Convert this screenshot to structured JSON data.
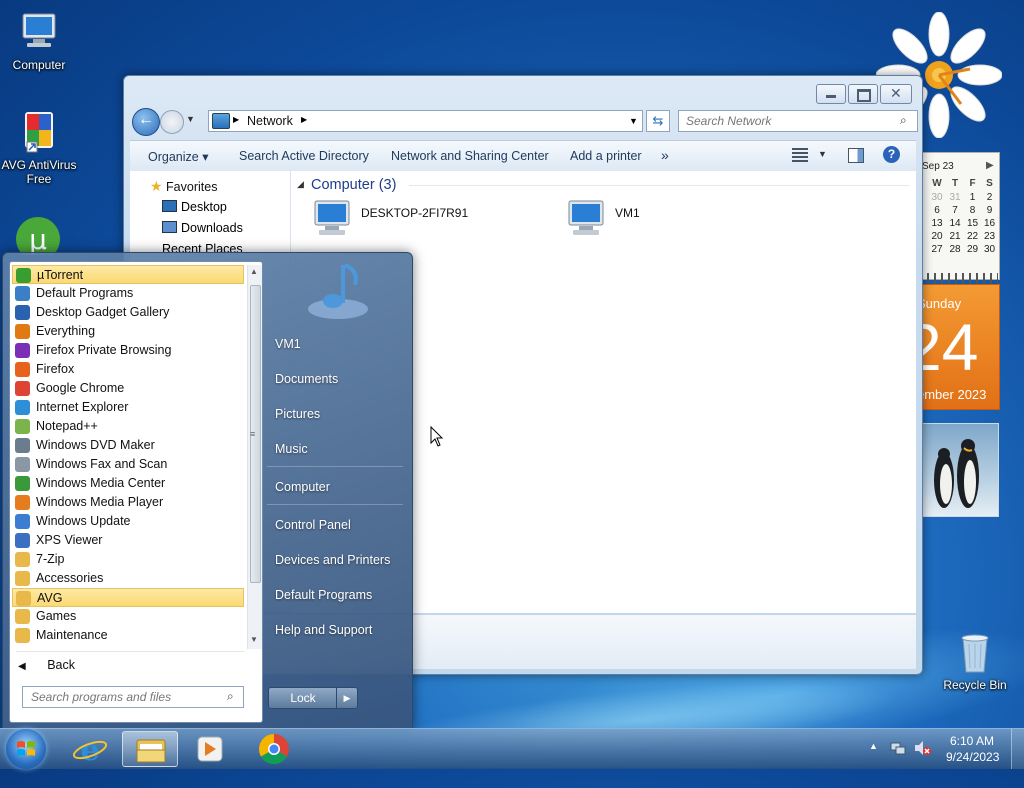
{
  "desktop": {
    "icons": [
      {
        "label": "Computer"
      },
      {
        "label": "AVG AntiVirus Free"
      },
      {
        "label": "Recycle Bin"
      }
    ]
  },
  "explorer": {
    "address_crumb": "Network",
    "search_placeholder": "Search Network",
    "toolbar": {
      "organize": "Organize",
      "search_ad": "Search Active Directory",
      "network_sharing": "Network and Sharing Center",
      "add_printer": "Add a printer",
      "more": "»"
    },
    "nav": {
      "favorites": "Favorites",
      "items": [
        "Desktop",
        "Downloads",
        "Recent Places"
      ]
    },
    "group_header": "Computer (3)",
    "computers": [
      "DESKTOP-2FI7R91",
      "VM1"
    ]
  },
  "start_menu": {
    "programs": [
      {
        "label": "µTorrent",
        "highlight": true,
        "color": "#3a9d2f"
      },
      {
        "label": "Default Programs",
        "color": "#3c7fc9"
      },
      {
        "label": "Desktop Gadget Gallery",
        "color": "#2a62b0"
      },
      {
        "label": "Everything",
        "color": "#e07a12"
      },
      {
        "label": "Firefox Private Browsing",
        "color": "#7b2fb5"
      },
      {
        "label": "Firefox",
        "color": "#e9621b"
      },
      {
        "label": "Google Chrome",
        "color": "#dd4433"
      },
      {
        "label": "Internet Explorer",
        "color": "#2c8fd8"
      },
      {
        "label": "Notepad++",
        "color": "#7bb34d"
      },
      {
        "label": "Windows DVD Maker",
        "color": "#6a7d8f"
      },
      {
        "label": "Windows Fax and Scan",
        "color": "#8a98a6"
      },
      {
        "label": "Windows Media Center",
        "color": "#3a9a3a"
      },
      {
        "label": "Windows Media Player",
        "color": "#e57d1f"
      },
      {
        "label": "Windows Update",
        "color": "#3b7ed1"
      },
      {
        "label": "XPS Viewer",
        "color": "#3b6fc1"
      },
      {
        "label": "7-Zip",
        "color": "#e8b84a"
      },
      {
        "label": "Accessories",
        "color": "#e8b84a"
      },
      {
        "label": "AVG",
        "highlight": true,
        "color": "#e8b84a"
      },
      {
        "label": "Games",
        "color": "#e8b84a"
      },
      {
        "label": "Maintenance",
        "color": "#e8b84a"
      }
    ],
    "back": "Back",
    "search_placeholder": "Search programs and files",
    "right_items": [
      "VM1",
      "Documents",
      "Pictures",
      "Music",
      "Computer",
      "Control Panel",
      "Devices and Printers",
      "Default Programs",
      "Help and Support"
    ],
    "lock": "Lock"
  },
  "gadgets": {
    "calendar": {
      "month_header": "Sep 23",
      "weekdays": [
        "W",
        "T",
        "F",
        "S"
      ],
      "rows": [
        [
          "30",
          "31",
          "1",
          "2"
        ],
        [
          "6",
          "7",
          "8",
          "9"
        ],
        [
          "13",
          "14",
          "15",
          "16"
        ],
        [
          "20",
          "21",
          "22",
          "23"
        ],
        [
          "27",
          "28",
          "29",
          "30"
        ]
      ],
      "day_name": "Sunday",
      "day_number": "24",
      "month_year": "ember 2023"
    }
  },
  "taskbar": {
    "time": "6:10 AM",
    "date": "9/24/2023"
  }
}
